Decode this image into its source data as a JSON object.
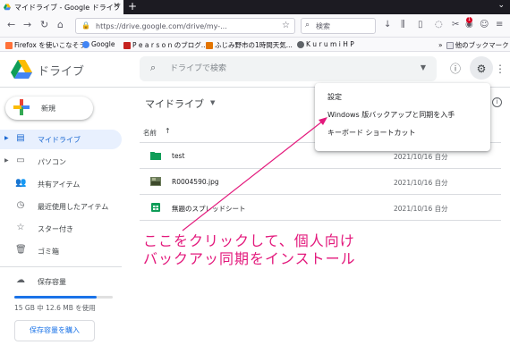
{
  "browser": {
    "tab_title": "マイドライブ - Google ドライブ",
    "url": "https://drive.google.com/drive/my-...",
    "search_placeholder": "検索",
    "notification_count": "1",
    "bookmarks": [
      "Firefox を使いこなそう",
      "Google",
      "P e a r s o n のブログ...",
      "ふじみ野市の1時間天気...",
      "K u r u m i   H P"
    ],
    "other_bookmarks": "他のブックマーク"
  },
  "drive": {
    "app_name": "ドライブ",
    "search_placeholder": "ドライブで検索"
  },
  "sidebar": {
    "new_label": "新規",
    "items": [
      {
        "label": "マイドライブ",
        "icon": "my-drive-icon",
        "active": true
      },
      {
        "label": "パソコン",
        "icon": "computer-icon",
        "active": false
      },
      {
        "label": "共有アイテム",
        "icon": "shared-icon",
        "active": false
      },
      {
        "label": "最近使用したアイテム",
        "icon": "recent-icon",
        "active": false
      },
      {
        "label": "スター付き",
        "icon": "star-icon",
        "active": false
      },
      {
        "label": "ゴミ箱",
        "icon": "trash-icon",
        "active": false
      }
    ],
    "storage_label": "保存容量",
    "storage_used_fraction": 0.84,
    "storage_text": "15 GB 中 12.6 MB を使用",
    "buy_storage_label": "保存容量を購入"
  },
  "main": {
    "title": "マイドライブ",
    "column_name": "名前",
    "sort_arrow": "↑",
    "files": [
      {
        "name": "test",
        "type": "folder",
        "date": "2021/10/16 自分"
      },
      {
        "name": "R0004590.jpg",
        "type": "image",
        "date": "2021/10/16 自分"
      },
      {
        "name": "無題のスプレッドシート",
        "type": "sheet",
        "date": "2021/10/16 自分"
      }
    ]
  },
  "settings_menu": {
    "items": [
      "設定",
      "Windows 版バックアップと同期を入手",
      "キーボード ショートカット"
    ]
  },
  "annotation": {
    "line1": "ここをクリックして、個人向け",
    "line2": "バックアッ同期をインストール",
    "color": "#e3197c"
  }
}
